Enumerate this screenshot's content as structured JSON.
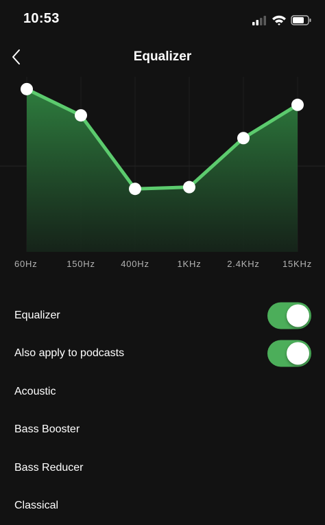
{
  "status_bar": {
    "time": "10:53",
    "icons": [
      "signal-icon",
      "wifi-icon",
      "battery-icon"
    ]
  },
  "header": {
    "title": "Equalizer",
    "back_icon": "chevron-left-icon"
  },
  "equalizer": {
    "bands": [
      {
        "label": "60Hz",
        "level": 0.93
      },
      {
        "label": "150Hz",
        "level": 0.78
      },
      {
        "label": "400Hz",
        "level": 0.36
      },
      {
        "label": "1KHz",
        "level": 0.37
      },
      {
        "label": "2.4KHz",
        "level": 0.65
      },
      {
        "label": "15KHz",
        "level": 0.84
      }
    ],
    "line_color": "#5ccb6e",
    "fill_color": "#2e7d3e"
  },
  "settings": {
    "toggles": [
      {
        "label": "Equalizer",
        "on": true
      },
      {
        "label": "Also apply to podcasts",
        "on": true
      }
    ],
    "presets": [
      "Acoustic",
      "Bass Booster",
      "Bass Reducer",
      "Classical"
    ]
  },
  "colors": {
    "background": "#121212",
    "accent": "#4cae5a"
  }
}
